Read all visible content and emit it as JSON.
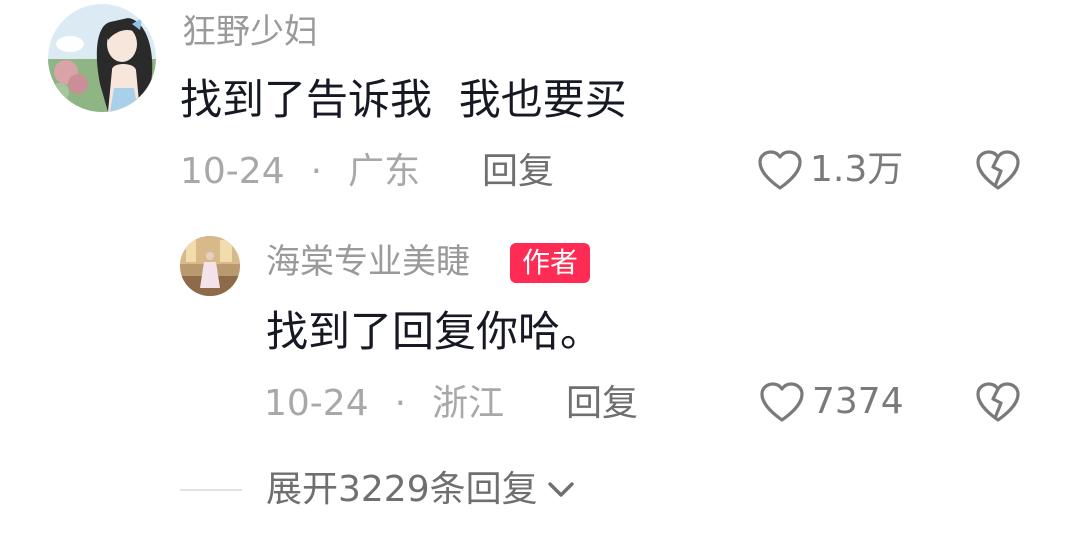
{
  "comment": {
    "username": "狂野少妇",
    "text": "找到了告诉我  我也要买",
    "date": "10-24",
    "separator": "·",
    "location": "广东",
    "reply_label": "回复",
    "likes": "1.3万",
    "avatar_icon": "anime-girl-avatar"
  },
  "reply": {
    "username": "海棠专业美睫",
    "badge": "作者",
    "text": "找到了回复你哈。",
    "date": "10-24",
    "separator": "·",
    "location": "浙江",
    "reply_label": "回复",
    "likes": "7374",
    "avatar_icon": "photo-avatar"
  },
  "expand": {
    "label": "展开3229条回复"
  },
  "colors": {
    "badge": "#fe2c55",
    "text": "#161823",
    "muted": "#a8a8a8"
  }
}
